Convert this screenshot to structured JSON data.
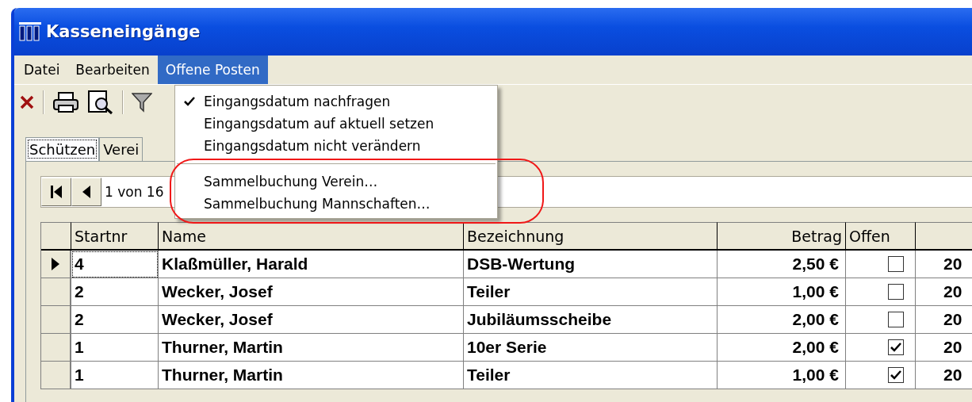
{
  "window": {
    "title": "Kasseneingänge"
  },
  "menu_bar": [
    {
      "label": "Datei",
      "selected": false
    },
    {
      "label": "Bearbeiten",
      "selected": false
    },
    {
      "label": "Offene Posten",
      "selected": true
    }
  ],
  "dropdown": [
    {
      "kind": "item",
      "label": "Eingangsdatum nachfragen",
      "checked": true
    },
    {
      "kind": "item",
      "label": "Eingangsdatum auf aktuell setzen",
      "checked": false
    },
    {
      "kind": "item",
      "label": "Eingangsdatum nicht verändern",
      "checked": false
    },
    {
      "kind": "separator"
    },
    {
      "kind": "item",
      "label": "Sammelbuchung Verein…",
      "checked": false
    },
    {
      "kind": "item",
      "label": "Sammelbuchung Mannschaften…",
      "checked": false
    }
  ],
  "tabs": [
    {
      "label": "Schützen",
      "selected": true
    },
    {
      "label": "Verei",
      "selected": false
    }
  ],
  "navigator": {
    "position": "1 von 16"
  },
  "table": {
    "columns": [
      "Startnr",
      "Name",
      "Bezeichnung",
      "Betrag",
      "Offen",
      ""
    ],
    "rows": [
      {
        "current": true,
        "startnr": "4",
        "name": "Klaßmüller, Harald",
        "bezeichnung": "DSB-Wertung",
        "betrag": "2,50 €",
        "offen": false,
        "column_7": "20"
      },
      {
        "current": false,
        "startnr": "2",
        "name": "Wecker, Josef",
        "bezeichnung": "Teiler",
        "betrag": "1,00 €",
        "offen": false,
        "column_7": "20"
      },
      {
        "current": false,
        "startnr": "2",
        "name": "Wecker, Josef",
        "bezeichnung": "Jubiläumsscheibe",
        "betrag": "2,00 €",
        "offen": false,
        "column_7": "20"
      },
      {
        "current": false,
        "startnr": "1",
        "name": "Thurner, Martin",
        "bezeichnung": "10er Serie",
        "betrag": "2,00 €",
        "offen": true,
        "column_7": "20"
      },
      {
        "current": false,
        "startnr": "1",
        "name": "Thurner, Martin",
        "bezeichnung": "Teiler",
        "betrag": "1,00 €",
        "offen": true,
        "column_7": "20"
      }
    ]
  }
}
